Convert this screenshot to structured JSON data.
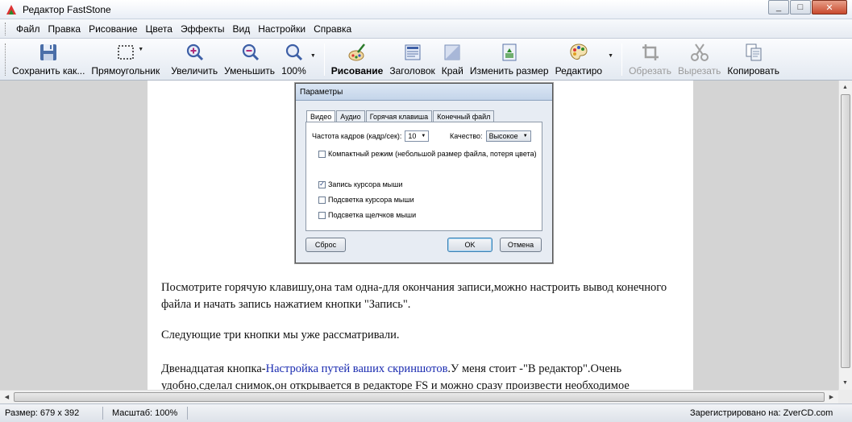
{
  "window": {
    "title": "Редактор FastStone",
    "min": "_",
    "max": "□",
    "close": "✕"
  },
  "menu": [
    "Файл",
    "Правка",
    "Рисование",
    "Цвета",
    "Эффекты",
    "Вид",
    "Настройки",
    "Справка"
  ],
  "toolbar": {
    "save": "Сохранить как...",
    "rect": "Прямоугольник",
    "zoom_in": "Увеличить",
    "zoom_out": "Уменьшить",
    "zoom": "100%",
    "draw": "Рисование",
    "header": "Заголовок",
    "edge": "Край",
    "resize": "Изменить размер",
    "editor": "Редактиро",
    "crop": "Обрезать",
    "cut": "Вырезать",
    "copy": "Копировать"
  },
  "dialog": {
    "title": "Параметры",
    "tabs": [
      "Видео",
      "Аудио",
      "Горячая клавиша",
      "Конечный файл"
    ],
    "fps_label": "Частота кадров (кадр/сек):",
    "fps_value": "10",
    "quality_label": "Качество:",
    "quality_value": "Высокое",
    "compact_mode": "Компактный режим (небольшой размер файла, потеря цвета)",
    "record_cursor": "Запись курсора мыши",
    "highlight_cursor": "Подсветка курсора мыши",
    "highlight_clicks": "Подсветка щелчков мыши",
    "reset": "Сброс",
    "ok": "OK",
    "cancel": "Отмена",
    "record_cursor_checked": true
  },
  "content": {
    "p1": "Посмотрите горячую клавишу,она там одна-для окончания записи,можно настроить вывод конечного файла и начать запись нажатием кнопки \"Запись\".",
    "p2": "Следующие три кнопки мы уже рассматривали.",
    "p3_before": "Двенадцатая кнопка-",
    "p3_link": "Настройка путей ваших скриншотов",
    "p3_after": ".У меня стоит -\"В редактор\".Очень удобно,сделал снимок,он открывается в редакторе FS и можно сразу произвести необходимое"
  },
  "status": {
    "size": "Размер: 679 x 392",
    "scale": "Масштаб: 100%",
    "registered": "Зарегистрировано на: ZverCD.com"
  }
}
